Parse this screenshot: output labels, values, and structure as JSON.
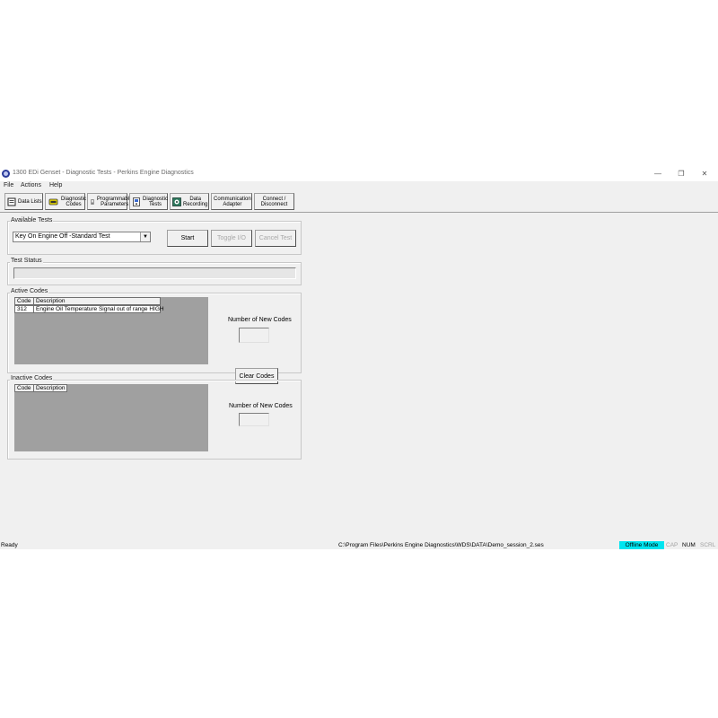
{
  "window": {
    "title": "1300 EDi Genset - Diagnostic Tests - Perkins Engine Diagnostics",
    "controls": {
      "minimize": "—",
      "maximize": "❐",
      "close": "✕"
    }
  },
  "menu": [
    "File",
    "Actions",
    "Help"
  ],
  "toolbar": {
    "data_lists": "Data Lists",
    "diagnostic_codes": [
      "Diagnostic",
      "Codes"
    ],
    "programmable_parameters": [
      "Programmable",
      "Parameters"
    ],
    "diagnostic_tests": [
      "Diagnostic",
      "Tests"
    ],
    "data_recording": [
      "Data",
      "Recording"
    ],
    "communication_adapter": [
      "Communication",
      "Adapter"
    ],
    "connect_disconnect": [
      "Connect /",
      "Disconnect"
    ]
  },
  "available_tests": {
    "label": "Available Tests",
    "selected": "Key On Engine Off -Standard Test",
    "start": "Start",
    "toggle_io": "Toggle I/O",
    "cancel_test": "Cancel Test"
  },
  "test_status": {
    "label": "Test Status"
  },
  "active_codes": {
    "label": "Active Codes",
    "columns": [
      "Code",
      "Description"
    ],
    "rows": [
      {
        "code": "312",
        "description": "Engine Oil Temperature Signal out of range HIGH"
      }
    ],
    "new_codes_label": "Number of New Codes",
    "clear_codes": "Clear Codes"
  },
  "inactive_codes": {
    "label": "Inactive Codes",
    "columns": [
      "Code",
      "Description"
    ],
    "new_codes_label": "Number of New Codes"
  },
  "status_bar": {
    "ready": "Ready",
    "path": "C:\\Program Files\\Perkins Engine Diagnostics\\WDS\\DATA\\Demo_session_2.ses",
    "offline": "Offline Mode",
    "cap": "CAP",
    "num": "NUM",
    "scrl": "SCRL"
  },
  "colors": {
    "offline_badge": "#00e5f0",
    "grid_bg": "#a0a0a0",
    "window_bg": "#f0f0f0"
  }
}
